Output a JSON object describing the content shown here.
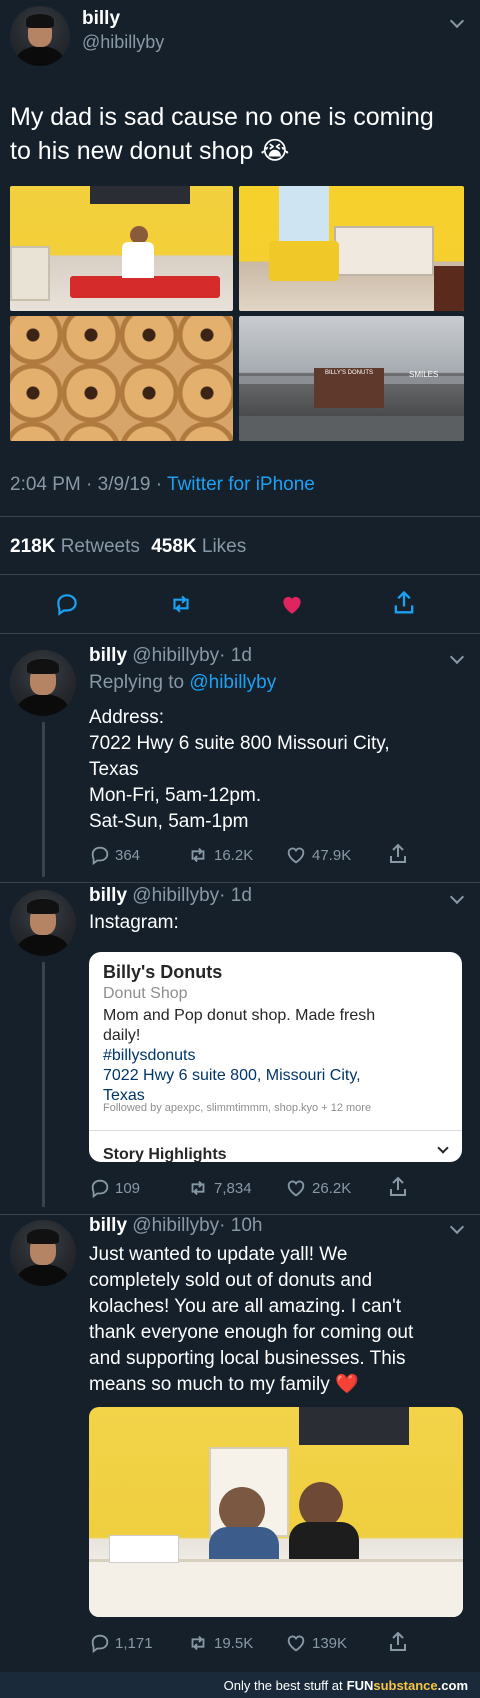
{
  "main_tweet": {
    "display_name": "billy",
    "handle": "@hibillyby",
    "text_line1": "My dad is sad cause no one is coming",
    "text_line2": "to his new donut shop",
    "emoji": "😭",
    "time": "2:04 PM",
    "date": "3/9/19",
    "dot": "·",
    "source": "Twitter for iPhone",
    "retweets_count": "218K",
    "retweets_label": "Retweets",
    "likes_count": "458K",
    "likes_label": "Likes",
    "store_sign_left": "BILLY'S DONUTS",
    "store_sign_right": "SMILES"
  },
  "reply1": {
    "display_name": "billy",
    "handle": "@hibillyby",
    "age": "· 1d",
    "replying_prefix": "Replying to",
    "replying_handle": "@hibillyby",
    "lines": [
      "Address:",
      "7022 Hwy 6 suite 800 Missouri City,",
      "Texas",
      "Mon-Fri, 5am-12pm.",
      "Sat-Sun, 5am-1pm"
    ],
    "replies": "364",
    "retweets": "16.2K",
    "likes": "47.9K"
  },
  "reply2": {
    "display_name": "billy",
    "handle": "@hibillyby",
    "age": "· 1d",
    "text": "Instagram:",
    "replies": "109",
    "retweets": "7,834",
    "likes": "26.2K",
    "ig": {
      "name": "Billy's Donuts",
      "category": "Donut Shop",
      "bio_line1": "Mom and Pop donut shop. Made fresh",
      "bio_line2": "daily!",
      "hashtag": "#billysdonuts",
      "address_line1": "7022 Hwy 6 suite 800, Missouri City,",
      "address_line2": "Texas",
      "followed_by": "Followed by apexpc, slimmtimmm, shop.kyo + 12 more",
      "highlights": "Story Highlights"
    }
  },
  "reply3": {
    "display_name": "billy",
    "handle": "@hibillyby",
    "age": "· 10h",
    "lines": [
      "Just wanted to update yall! We",
      "completely sold out of donuts and",
      "kolaches! You are all amazing. I can't",
      "thank everyone enough for coming out",
      "and supporting local businesses. This",
      "means so much to my family"
    ],
    "emoji": "❤️",
    "replies": "1,171",
    "retweets": "19.5K",
    "likes": "139K"
  },
  "footer": {
    "tagline": "Only the best stuff at",
    "brand_a": "FUN",
    "brand_b": "substance",
    "brand_c": ".com"
  },
  "colors": {
    "background": "#15202b",
    "link": "#1da1f2",
    "muted": "#8899a6",
    "like_active": "#e0245e"
  },
  "icons": [
    "chevron-down-icon",
    "reply-icon",
    "retweet-icon",
    "heart-icon",
    "share-icon"
  ]
}
